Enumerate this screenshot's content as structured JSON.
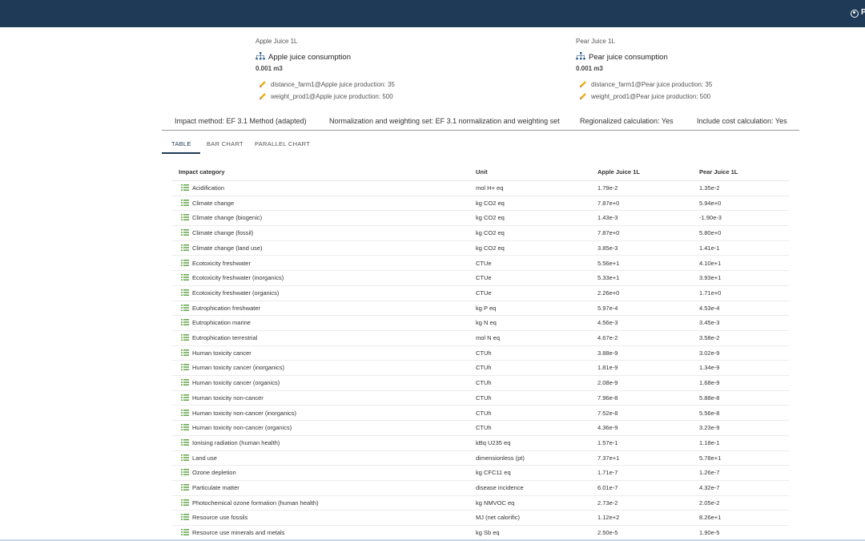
{
  "header": {
    "user_initial": "P",
    "user_icon": "account-circle-icon"
  },
  "products": [
    {
      "name": "Apple Juice 1L",
      "reference": "Apple juice consumption",
      "amount": "0.001 m3",
      "parameters": [
        "distance_farm1@Apple juice production: 35",
        "weight_prod1@Apple juice production: 500"
      ]
    },
    {
      "name": "Pear Juice 1L",
      "reference": "Pear juice consumption",
      "amount": "0.001 m3",
      "parameters": [
        "distance_farm1@Pear juice production: 35",
        "weight_prod1@Pear juice production: 500"
      ]
    }
  ],
  "settings": {
    "impact_method": "Impact method: EF 3.1 Method (adapted)",
    "nw_set": "Normalization and weighting set: EF 3.1 normalization and weighting set",
    "regionalized": "Regionalized calculation: Yes",
    "cost": "Include cost calculation: Yes"
  },
  "tabs": [
    "TABLE",
    "BAR CHART",
    "PARALLEL CHART"
  ],
  "active_tab": "TABLE",
  "table": {
    "columns": [
      "Impact category",
      "Unit",
      "Apple Juice 1L",
      "Pear Juice 1L"
    ],
    "rows": [
      [
        "Acidification",
        "mol H+ eq",
        "1.79e-2",
        "1.35e-2"
      ],
      [
        "Climate change",
        "kg CO2 eq",
        "7.87e+0",
        "5.94e+0"
      ],
      [
        "Climate change (biogenic)",
        "kg CO2 eq",
        "1.43e-3",
        "-1.90e-3"
      ],
      [
        "Climate change (fossil)",
        "kg CO2 eq",
        "7.87e+0",
        "5.80e+0"
      ],
      [
        "Climate change (land use)",
        "kg CO2 eq",
        "3.85e-3",
        "1.41e-1"
      ],
      [
        "Ecotoxicity freshwater",
        "CTUe",
        "5.56e+1",
        "4.10e+1"
      ],
      [
        "Ecotoxicity freshwater (inorganics)",
        "CTUe",
        "5.33e+1",
        "3.93e+1"
      ],
      [
        "Ecotoxicity freshwater (organics)",
        "CTUe",
        "2.26e+0",
        "1.71e+0"
      ],
      [
        "Eutrophication freshwater",
        "kg P eq",
        "5.97e-4",
        "4.53e-4"
      ],
      [
        "Eutrophication marine",
        "kg N eq",
        "4.56e-3",
        "3.45e-3"
      ],
      [
        "Eutrophication terrestrial",
        "mol N eq",
        "4.67e-2",
        "3.58e-2"
      ],
      [
        "Human toxicity cancer",
        "CTUh",
        "3.88e-9",
        "3.02e-9"
      ],
      [
        "Human toxicity cancer (inorganics)",
        "CTUh",
        "1.81e-9",
        "1.34e-9"
      ],
      [
        "Human toxicity cancer (organics)",
        "CTUh",
        "2.08e-9",
        "1.68e-9"
      ],
      [
        "Human toxicity non-cancer",
        "CTUh",
        "7.96e-8",
        "5.88e-8"
      ],
      [
        "Human toxicity non-cancer (inorganics)",
        "CTUh",
        "7.52e-8",
        "5.56e-8"
      ],
      [
        "Human toxicity non-cancer (organics)",
        "CTUh",
        "4.36e-9",
        "3.23e-9"
      ],
      [
        "Ionising radiation (human health)",
        "kBq U235 eq",
        "1.57e-1",
        "1.18e-1"
      ],
      [
        "Land use",
        "dimensionless (pt)",
        "7.37e+1",
        "5.78e+1"
      ],
      [
        "Ozone depletion",
        "kg CFC11 eq",
        "1.71e-7",
        "1.26e-7"
      ],
      [
        "Particulate matter",
        "disease incidence",
        "6.01e-7",
        "4.32e-7"
      ],
      [
        "Photochemical ozone formation (human health)",
        "kg NMVOC eq",
        "2.73e-2",
        "2.05e-2"
      ],
      [
        "Resource use fossils",
        "MJ (net calorific)",
        "1.12e+2",
        "8.26e+1"
      ],
      [
        "Resource use minerals and metals",
        "kg Sb eq",
        "2.50e-5",
        "1.90e-5"
      ]
    ]
  },
  "colors": {
    "header_bg": "#1f3a57",
    "row_icon": "#6aa84f",
    "pencil": "#f0a500",
    "tree_icon": "#2b5c8a"
  }
}
